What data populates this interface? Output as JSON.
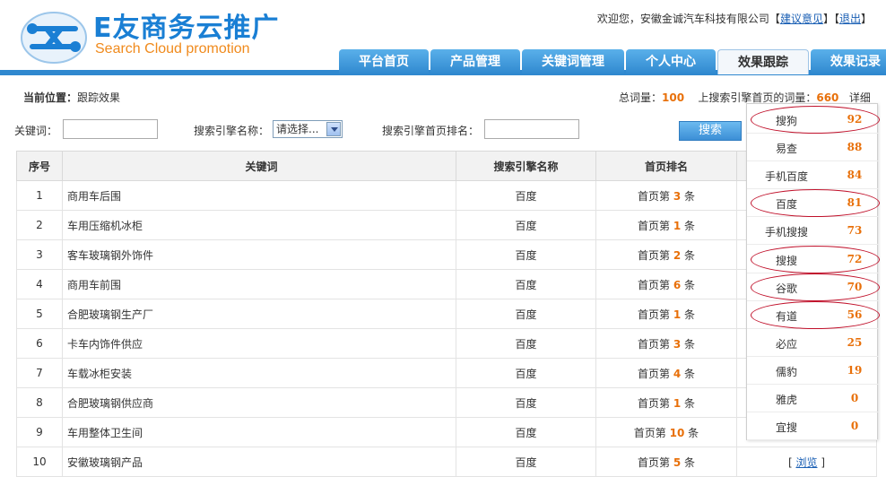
{
  "header": {
    "logo_title": "E友商务云推广",
    "logo_subtitle": "Search Cloud promotion",
    "welcome_prefix": "欢迎您，安徽金诚汽车科技有限公司【",
    "feedback_link": "建议意见",
    "separator": "】【",
    "logout_link": "退出",
    "welcome_suffix": "】"
  },
  "nav": {
    "tabs": [
      {
        "label": "平台首页",
        "active": false
      },
      {
        "label": "产品管理",
        "active": false
      },
      {
        "label": "关键词管理",
        "active": false
      },
      {
        "label": "个人中心",
        "active": false
      },
      {
        "label": "效果跟踪",
        "active": true
      },
      {
        "label": "效果记录",
        "active": false
      }
    ]
  },
  "location": {
    "label": "当前位置：",
    "value": "跟踪效果"
  },
  "stats": {
    "total_label": "总词量：",
    "total_value": "100",
    "top_label": "上搜索引擎首页的词量：",
    "top_value": "660",
    "detail": "详细"
  },
  "search": {
    "keyword_label": "关键词：",
    "engine_label": "搜索引擎名称：",
    "engine_selected": "请选择...",
    "rank_label": "搜索引擎首页排名：",
    "button": "搜索"
  },
  "table": {
    "headers": [
      "序号",
      "关键词",
      "搜索引擎名称",
      "首页排名"
    ],
    "rank_prefix": "首页第",
    "rank_suffix": "条",
    "rows": [
      {
        "num": "1",
        "keyword": "商用车后围",
        "engine": "百度",
        "rank": "3"
      },
      {
        "num": "2",
        "keyword": "车用压缩机冰柜",
        "engine": "百度",
        "rank": "1"
      },
      {
        "num": "3",
        "keyword": "客车玻璃钢外饰件",
        "engine": "百度",
        "rank": "2"
      },
      {
        "num": "4",
        "keyword": "商用车前围",
        "engine": "百度",
        "rank": "6"
      },
      {
        "num": "5",
        "keyword": "合肥玻璃钢生产厂",
        "engine": "百度",
        "rank": "1"
      },
      {
        "num": "6",
        "keyword": "卡车内饰件供应",
        "engine": "百度",
        "rank": "3"
      },
      {
        "num": "7",
        "keyword": "车载冰柜安装",
        "engine": "百度",
        "rank": "4"
      },
      {
        "num": "8",
        "keyword": "合肥玻璃钢供应商",
        "engine": "百度",
        "rank": "1"
      },
      {
        "num": "9",
        "keyword": "车用整体卫生间",
        "engine": "百度",
        "rank": "10"
      },
      {
        "num": "10",
        "keyword": "安徽玻璃钢产品",
        "engine": "百度",
        "rank": "5",
        "action": "浏览"
      }
    ]
  },
  "popup": {
    "items": [
      {
        "name": "搜狗",
        "value": "92",
        "circled": true
      },
      {
        "name": "易查",
        "value": "88",
        "circled": false
      },
      {
        "name": "手机百度",
        "value": "84",
        "circled": false
      },
      {
        "name": "百度",
        "value": "81",
        "circled": true
      },
      {
        "name": "手机搜搜",
        "value": "73",
        "circled": false
      },
      {
        "name": "搜搜",
        "value": "72",
        "circled": true
      },
      {
        "name": "谷歌",
        "value": "70",
        "circled": true
      },
      {
        "name": "有道",
        "value": "56",
        "circled": true
      },
      {
        "name": "必应",
        "value": "25",
        "circled": false
      },
      {
        "name": "儒豹",
        "value": "19",
        "circled": false
      },
      {
        "name": "雅虎",
        "value": "0",
        "circled": false
      },
      {
        "name": "宜搜",
        "value": "0",
        "circled": false
      }
    ]
  },
  "colors": {
    "accent": "#2f88cf",
    "highlight": "#e8700a",
    "ring": "#c0102a"
  }
}
